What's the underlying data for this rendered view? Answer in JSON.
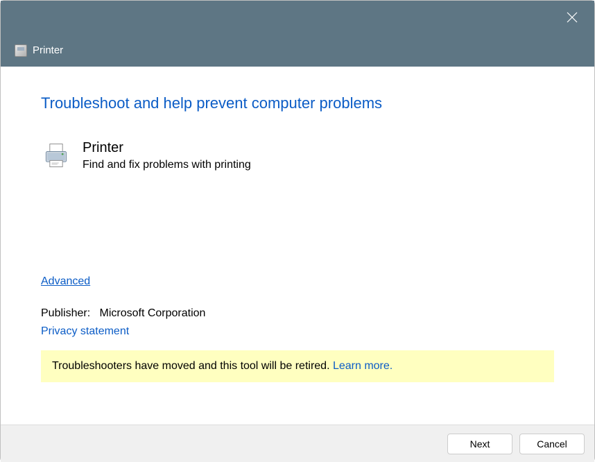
{
  "titlebar": {
    "close_label": "Close"
  },
  "header": {
    "title": "Printer"
  },
  "main": {
    "heading": "Troubleshoot and help prevent computer problems",
    "section_title": "Printer",
    "section_desc": "Find and fix problems with printing",
    "advanced_link": "Advanced",
    "publisher_label": "Publisher:",
    "publisher_value": "Microsoft Corporation",
    "privacy_link": "Privacy statement",
    "banner_text": "Troubleshooters have moved and this tool will be retired. ",
    "banner_link": "Learn more."
  },
  "footer": {
    "next_label": "Next",
    "cancel_label": "Cancel"
  }
}
